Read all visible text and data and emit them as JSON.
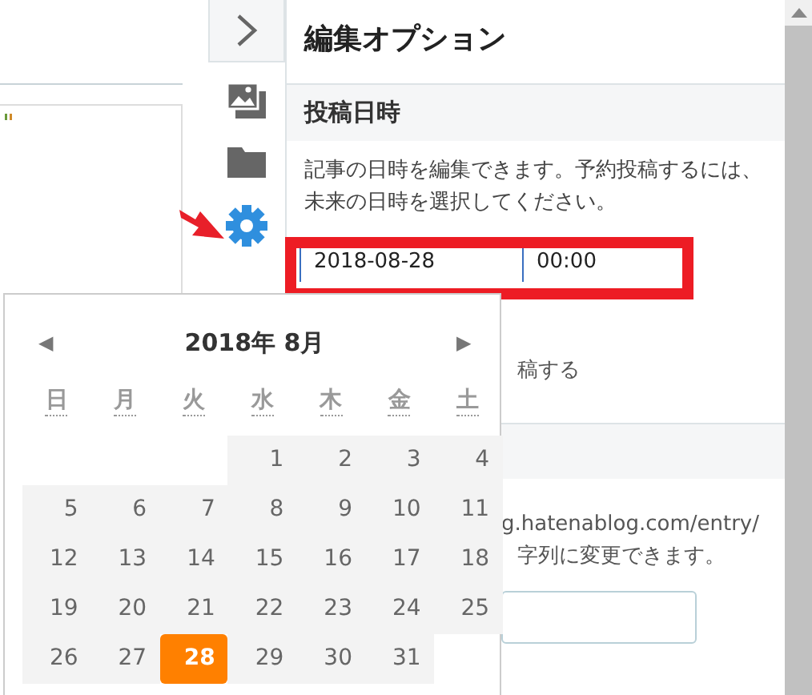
{
  "panel": {
    "title": "編集オプション",
    "date_section": {
      "heading": "投稿日時",
      "description": "記事の日時を編集できます。予約投稿するには、未来の日時を選択してください。",
      "date_value": "2018-08-28",
      "time_value": "00:00",
      "option_label": "稿する"
    },
    "url_section": {
      "url_text": "g.hatenablog.com/entry/",
      "note": "字列に変更できます。"
    }
  },
  "calendar": {
    "title": "2018年 8月",
    "prev": "◀",
    "next": "▶",
    "weekdays": [
      "日",
      "月",
      "火",
      "水",
      "木",
      "金",
      "土"
    ],
    "weeks": [
      [
        {
          "label": "1",
          "selected": false
        },
        {
          "label": "2",
          "selected": false
        },
        {
          "label": "3",
          "selected": false
        },
        {
          "label": "4",
          "selected": false
        }
      ],
      [
        {
          "label": "5",
          "selected": false
        },
        {
          "label": "6",
          "selected": false
        },
        {
          "label": "7",
          "selected": false
        },
        {
          "label": "8",
          "selected": false
        },
        {
          "label": "9",
          "selected": false
        },
        {
          "label": "10",
          "selected": false
        },
        {
          "label": "11",
          "selected": false
        }
      ],
      [
        {
          "label": "12",
          "selected": false
        },
        {
          "label": "13",
          "selected": false
        },
        {
          "label": "14",
          "selected": false
        },
        {
          "label": "15",
          "selected": false
        },
        {
          "label": "16",
          "selected": false
        },
        {
          "label": "17",
          "selected": false
        },
        {
          "label": "18",
          "selected": false
        }
      ],
      [
        {
          "label": "19",
          "selected": false
        },
        {
          "label": "20",
          "selected": false
        },
        {
          "label": "21",
          "selected": false
        },
        {
          "label": "22",
          "selected": false
        },
        {
          "label": "23",
          "selected": false
        },
        {
          "label": "24",
          "selected": false
        },
        {
          "label": "25",
          "selected": false
        }
      ],
      [
        {
          "label": "26",
          "selected": false
        },
        {
          "label": "27",
          "selected": false
        },
        {
          "label": "28",
          "selected": true
        },
        {
          "label": "29",
          "selected": false
        },
        {
          "label": "30",
          "selected": false
        },
        {
          "label": "31",
          "selected": false
        }
      ]
    ]
  }
}
